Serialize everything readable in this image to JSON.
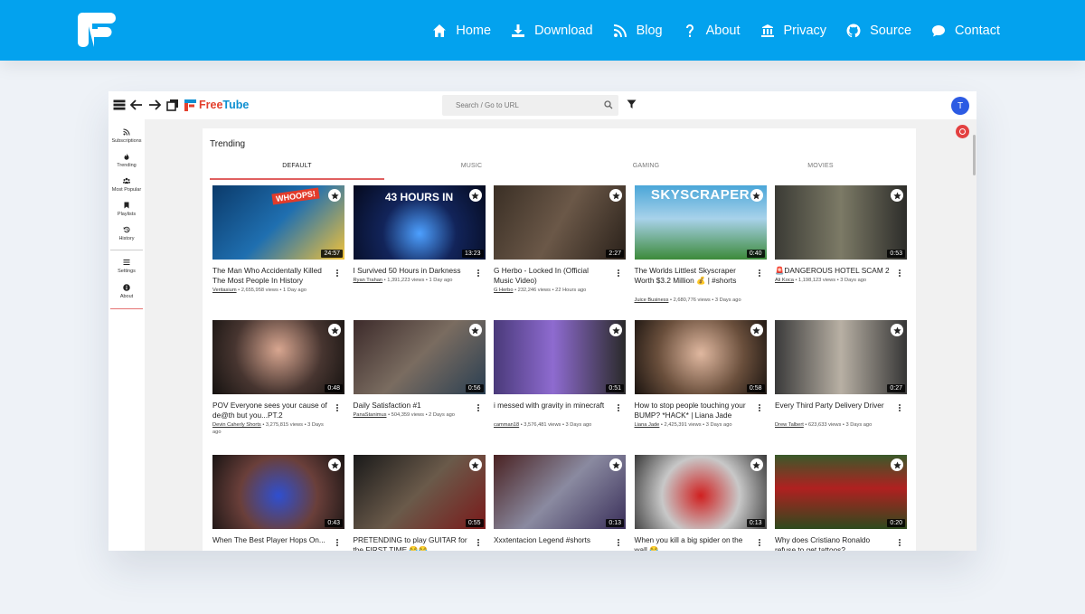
{
  "site": {
    "nav": [
      {
        "label": "Home",
        "icon": "home-icon"
      },
      {
        "label": "Download",
        "icon": "download-icon"
      },
      {
        "label": "Blog",
        "icon": "rss-icon"
      },
      {
        "label": "About",
        "icon": "question-icon"
      },
      {
        "label": "Privacy",
        "icon": "building-icon"
      },
      {
        "label": "Source",
        "icon": "github-icon"
      },
      {
        "label": "Contact",
        "icon": "chat-icon"
      }
    ],
    "brand_color": "#03a2ee"
  },
  "app": {
    "logo_free": "Free",
    "logo_tube": "Tube",
    "search_placeholder": "Search / Go to URL",
    "avatar_letter": "T",
    "sidebar": [
      {
        "label": "Subscriptions",
        "icon": "rss-icon"
      },
      {
        "label": "Trending",
        "icon": "fire-icon"
      },
      {
        "label": "Most Popular",
        "icon": "users-icon"
      },
      {
        "label": "Playlists",
        "icon": "bookmark-icon"
      },
      {
        "label": "History",
        "icon": "history-icon"
      },
      {
        "label": "Settings",
        "icon": "sliders-icon"
      },
      {
        "label": "About",
        "icon": "info-icon"
      }
    ],
    "page_title": "Trending",
    "tabs": [
      "DEFAULT",
      "MUSIC",
      "GAMING",
      "MOVIES"
    ],
    "videos": [
      {
        "title": "The Man Who Accidentally Killed The Most People In History",
        "channel": "Veritasium",
        "meta": " • 2,655,958 views • 1 Day ago",
        "duration": "24:57",
        "thumb_text": "WHOOPS!"
      },
      {
        "title": "I Survived 50 Hours in Darkness",
        "channel": "Ryan Trahan",
        "meta": " • 1,391,223 views • 1 Day ago",
        "duration": "13:23",
        "thumb_text": "43 HOURS IN"
      },
      {
        "title": "G Herbo - Locked In (Official Music Video)",
        "channel": "G Herbo",
        "meta": " • 232,246 views • 22 Hours ago",
        "duration": "2:27",
        "thumb_text": ""
      },
      {
        "title": "The Worlds Littlest Skyscraper Worth $3.2 Million 💰 | #shorts",
        "channel": "Juice Business",
        "meta": " • 2,680,776 views • 3 Days ago",
        "duration": "0:40",
        "thumb_text": "SKYSCRAPER"
      },
      {
        "title": "🚨DANGEROUS HOTEL SCAM 2",
        "channel": "Ali Koca",
        "meta": " • 1,198,123 views • 3 Days ago",
        "duration": "0:53",
        "thumb_text": ""
      },
      {
        "title": "POV Everyone sees your cause of de@th but you...PT.2",
        "channel": "Devin Caherly Shorts",
        "meta": " • 3,275,815 views • 3 Days ago",
        "duration": "0:48",
        "thumb_text": ""
      },
      {
        "title": "Daily Satisfaction #1",
        "channel": "PanaStanimus",
        "meta": " • 504,359 views • 2 Days ago",
        "duration": "0:56",
        "thumb_text": ""
      },
      {
        "title": "i messed with gravity in minecraft",
        "channel": "camman18",
        "meta": " • 3,576,481 views • 3 Days ago",
        "duration": "0:51",
        "thumb_text": ""
      },
      {
        "title": "How to stop people touching your BUMP? *HACK* | Liana Jade",
        "channel": "Liana Jade",
        "meta": " • 2,425,391 views • 3 Days ago",
        "duration": "0:58",
        "thumb_text": ""
      },
      {
        "title": "Every Third Party Delivery Driver",
        "channel": "Drew Talbert",
        "meta": " • 623,633 views • 3 Days ago",
        "duration": "0:27",
        "thumb_text": ""
      },
      {
        "title": "When The Best Player Hops On...",
        "channel": "",
        "meta": "",
        "duration": "0:43",
        "thumb_text": ""
      },
      {
        "title": "PRETENDING to play GUITAR for the FIRST TIME 😂😂",
        "channel": "",
        "meta": "",
        "duration": "0:55",
        "thumb_text": ""
      },
      {
        "title": "Xxxtentacion Legend #shorts",
        "channel": "",
        "meta": "",
        "duration": "0:13",
        "thumb_text": ""
      },
      {
        "title": "When you kill a big spider on the wall 😂",
        "channel": "",
        "meta": "",
        "duration": "0:13",
        "thumb_text": ""
      },
      {
        "title": "Why does Cristiano Ronaldo refuse to get tattoos?",
        "channel": "",
        "meta": "",
        "duration": "0:20",
        "thumb_text": ""
      }
    ]
  }
}
